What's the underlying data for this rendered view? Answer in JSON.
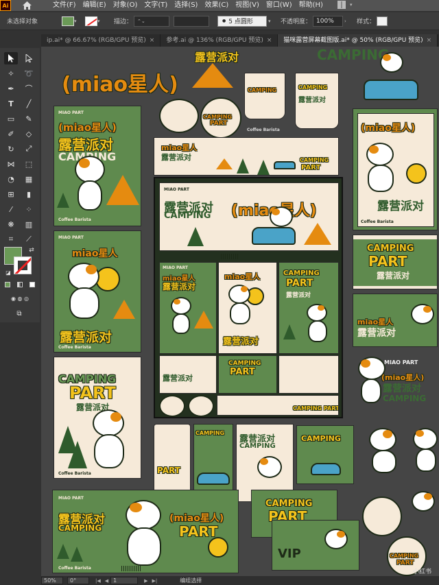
{
  "app": {
    "logo": "Ai",
    "menu": [
      "文件(F)",
      "编辑(E)",
      "对象(O)",
      "文字(T)",
      "选择(S)",
      "效果(C)",
      "视图(V)",
      "窗口(W)",
      "帮助(H)"
    ]
  },
  "control_bar": {
    "selection_status": "未选择对象",
    "stroke_label": "描边：",
    "brush_value": "5 点圆形",
    "opacity_label": "不透明度：",
    "opacity_value": "100%",
    "style_label": "样式："
  },
  "tabs": [
    {
      "label": "ip.ai* @ 66.67% (RGB/GPU 预览)",
      "active": false
    },
    {
      "label": "参考.ai @ 136% (RGB/GPU 预览)",
      "active": false
    },
    {
      "label": "猫咪露营屏幕截图版.ai* @ 50% (RGB/GPU 预览)",
      "active": true
    }
  ],
  "artboards": {
    "miao": "(miao星人)",
    "miao_short": "miao星人",
    "lu_ying": "露营派对",
    "camping": "CAMPING",
    "part": "PART",
    "camping_part": "CAMPING PART",
    "miao_part": "MIAO PART",
    "coffee": "Coffee Barista",
    "vip": "VIP"
  },
  "status_bar": {
    "zoom": "50%",
    "rotation": "0°",
    "artboard_number": "1",
    "tool_status": "编组选择"
  },
  "watermark": "小红书",
  "colors": {
    "green": "#5f8a4e",
    "orange": "#e58b10",
    "yellow": "#f4c31c",
    "cream": "#f6ead9",
    "dark": "#23301f"
  }
}
